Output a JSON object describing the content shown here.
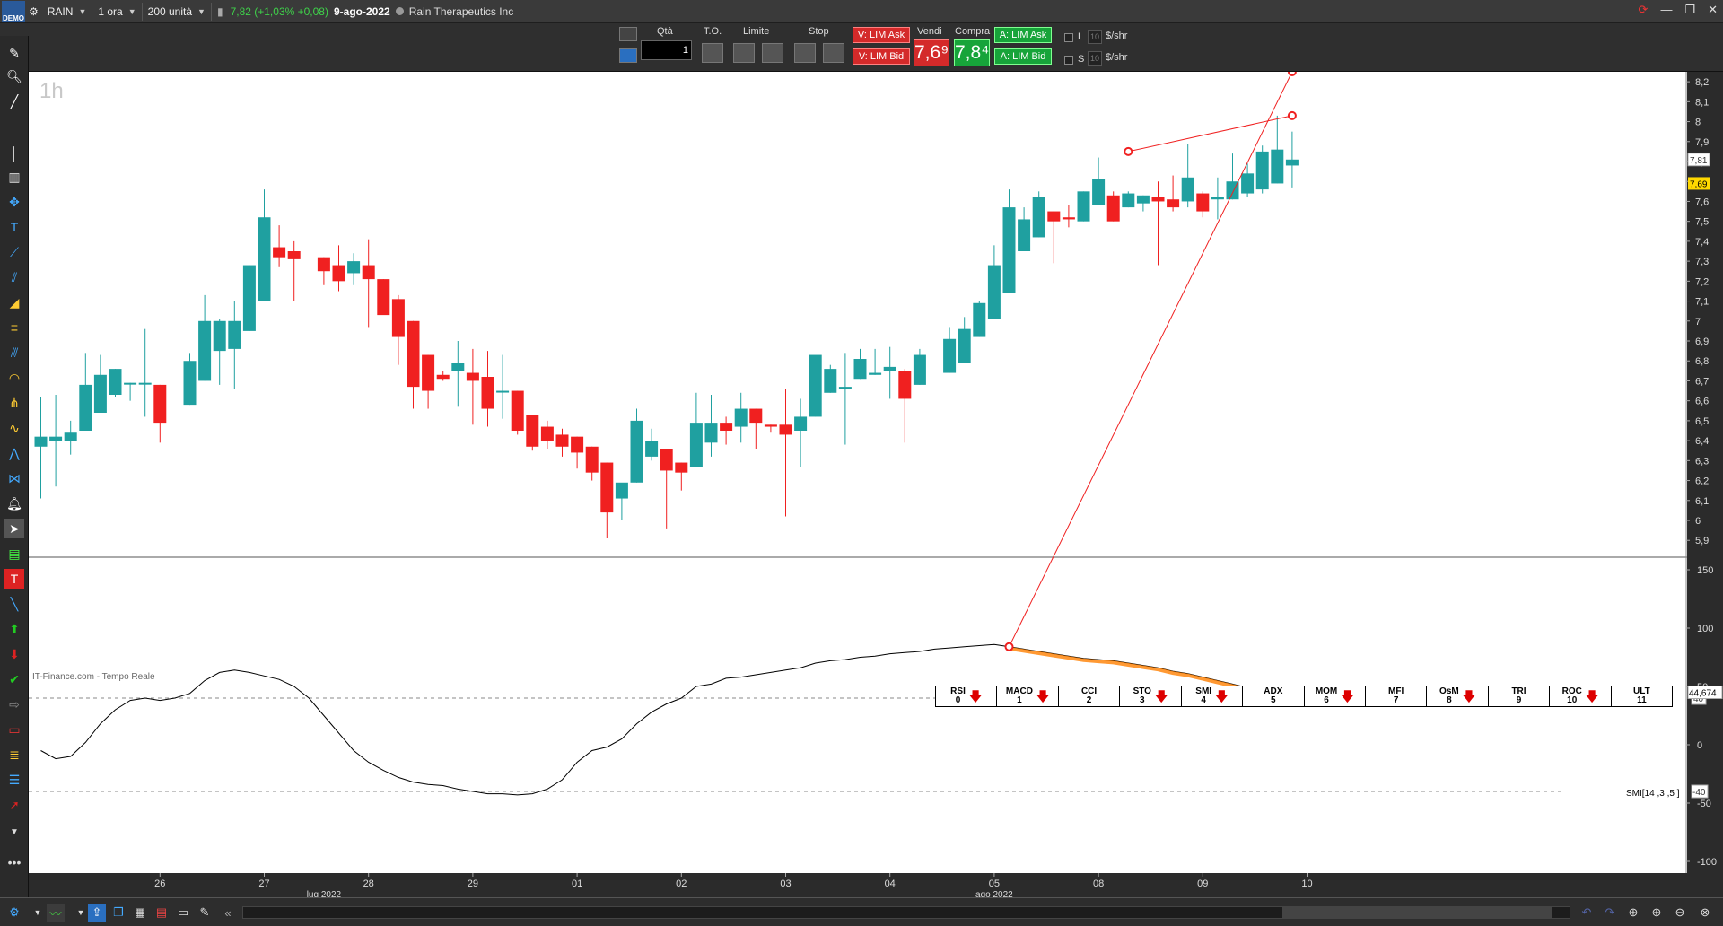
{
  "titlebar": {
    "logo": "DEMO",
    "symbol": "RAIN",
    "timeframe": "1 ora",
    "units": "200 unità",
    "price_change": "7,82 (+1,03% +0,08)",
    "date": "9-ago-2022",
    "company": "Rain Therapeutics Inc",
    "minimize": "—",
    "restore": "❐",
    "close": "✕"
  },
  "tradebar": {
    "qty_label": "Qtà",
    "qty_value": "1",
    "to_label": "T.O.",
    "limit_label": "Limite",
    "stop_label": "Stop",
    "sell_ask": "V: LIM Ask",
    "sell_bid": "V: LIM Bid",
    "vendi_label": "Vendi",
    "vendi_price": "7,6⁹",
    "compra_label": "Compra",
    "compra_price": "7,8⁴",
    "buy_ask": "A: LIM Ask",
    "buy_bid": "A: LIM Bid",
    "l_label": "L",
    "s_label": "S",
    "l_box": "10",
    "s_box": "10",
    "per_share1": "$/shr",
    "per_share2": "$/shr"
  },
  "chart": {
    "timeframe_watermark": "1h",
    "source_label": "IT-Finance.com - Tempo Reale",
    "indicator_label": "SMI[14 ,3 ,5 ]",
    "last_price_tag": "7,81",
    "bid_price_tag": "7,69",
    "smi_value_tag": "44,674",
    "smi_level_pos": "40",
    "smi_level_neg": "-40",
    "colors": {
      "up": "#1fa0a0",
      "down": "#f02020",
      "trend": "#f02020",
      "smi_line": "#000000",
      "smi_fill": "#ff8000"
    }
  },
  "indicator_tabs": [
    {
      "name": "RSI",
      "num": "0",
      "arrow": true
    },
    {
      "name": "MACD",
      "num": "1",
      "arrow": true
    },
    {
      "name": "CCI",
      "num": "2",
      "arrow": false
    },
    {
      "name": "STO",
      "num": "3",
      "arrow": true
    },
    {
      "name": "SMI",
      "num": "4",
      "arrow": true
    },
    {
      "name": "ADX",
      "num": "5",
      "arrow": false
    },
    {
      "name": "MOM",
      "num": "6",
      "arrow": true
    },
    {
      "name": "MFI",
      "num": "7",
      "arrow": false
    },
    {
      "name": "OsM",
      "num": "8",
      "arrow": true
    },
    {
      "name": "TRI",
      "num": "9",
      "arrow": false
    },
    {
      "name": "ROC",
      "num": "10",
      "arrow": true
    },
    {
      "name": "ULT",
      "num": "11",
      "arrow": false
    }
  ],
  "chart_data": {
    "type": "candlestick",
    "price_axis": {
      "ylim": [
        5.82,
        8.25
      ],
      "ticks": [
        "8,2",
        "8,1",
        "8",
        "7,9",
        "7,8",
        "7,7",
        "7,6",
        "7,5",
        "7,4",
        "7,3",
        "7,2",
        "7,1",
        "7",
        "6,9",
        "6,8",
        "6,7",
        "6,6",
        "6,5",
        "6,4",
        "6,3",
        "6,2",
        "6,1",
        "6",
        "5,9"
      ]
    },
    "x_axis": {
      "day_labels": [
        "26",
        "27",
        "28",
        "29",
        "01",
        "02",
        "03",
        "04",
        "05",
        "08",
        "09",
        "10"
      ],
      "month_labels": [
        "lug 2022",
        "ago 2022"
      ]
    },
    "candles": [
      {
        "o": 6.37,
        "h": 6.62,
        "l": 6.11,
        "c": 6.42
      },
      {
        "o": 6.4,
        "h": 6.63,
        "l": 6.17,
        "c": 6.42
      },
      {
        "o": 6.4,
        "h": 6.5,
        "l": 6.33,
        "c": 6.44
      },
      {
        "o": 6.45,
        "h": 6.84,
        "l": 6.45,
        "c": 6.68
      },
      {
        "o": 6.54,
        "h": 6.83,
        "l": 6.54,
        "c": 6.73
      },
      {
        "o": 6.63,
        "h": 6.76,
        "l": 6.62,
        "c": 6.76
      },
      {
        "o": 6.69,
        "h": 6.69,
        "l": 6.6,
        "c": 6.69
      },
      {
        "o": 6.69,
        "h": 6.96,
        "l": 6.52,
        "c": 6.69
      },
      {
        "o": 6.68,
        "h": 6.68,
        "l": 6.39,
        "c": 6.49
      },
      null,
      {
        "o": 6.58,
        "h": 6.84,
        "l": 6.58,
        "c": 6.8
      },
      {
        "o": 6.7,
        "h": 7.13,
        "l": 6.7,
        "c": 7.0
      },
      {
        "o": 6.85,
        "h": 7.01,
        "l": 6.68,
        "c": 7.0
      },
      {
        "o": 6.86,
        "h": 7.1,
        "l": 6.66,
        "c": 7.0
      },
      {
        "o": 6.95,
        "h": 7.28,
        "l": 6.95,
        "c": 7.28
      },
      {
        "o": 7.1,
        "h": 7.66,
        "l": 7.1,
        "c": 7.52
      },
      {
        "o": 7.37,
        "h": 7.48,
        "l": 7.27,
        "c": 7.32
      },
      {
        "o": 7.35,
        "h": 7.4,
        "l": 7.1,
        "c": 7.31
      },
      null,
      {
        "o": 7.32,
        "h": 7.32,
        "l": 7.18,
        "c": 7.25
      },
      {
        "o": 7.28,
        "h": 7.38,
        "l": 7.15,
        "c": 7.2
      },
      {
        "o": 7.24,
        "h": 7.34,
        "l": 7.18,
        "c": 7.3
      },
      {
        "o": 7.28,
        "h": 7.41,
        "l": 6.97,
        "c": 7.21
      },
      {
        "o": 7.21,
        "h": 7.21,
        "l": 7.05,
        "c": 7.03
      },
      {
        "o": 7.11,
        "h": 7.13,
        "l": 6.78,
        "c": 6.92
      },
      {
        "o": 7.0,
        "h": 7.0,
        "l": 6.56,
        "c": 6.67
      },
      {
        "o": 6.83,
        "h": 6.83,
        "l": 6.56,
        "c": 6.65
      },
      {
        "o": 6.73,
        "h": 6.75,
        "l": 6.7,
        "c": 6.71
      },
      {
        "o": 6.75,
        "h": 6.9,
        "l": 6.57,
        "c": 6.79
      },
      {
        "o": 6.74,
        "h": 6.86,
        "l": 6.48,
        "c": 6.7
      },
      {
        "o": 6.72,
        "h": 6.85,
        "l": 6.47,
        "c": 6.56
      },
      {
        "o": 6.65,
        "h": 6.83,
        "l": 6.51,
        "c": 6.65
      },
      {
        "o": 6.65,
        "h": 6.65,
        "l": 6.43,
        "c": 6.45
      },
      {
        "o": 6.53,
        "h": 6.53,
        "l": 6.35,
        "c": 6.37
      },
      {
        "o": 6.47,
        "h": 6.5,
        "l": 6.36,
        "c": 6.4
      },
      {
        "o": 6.43,
        "h": 6.46,
        "l": 6.32,
        "c": 6.37
      },
      {
        "o": 6.42,
        "h": 6.42,
        "l": 6.26,
        "c": 6.34
      },
      {
        "o": 6.37,
        "h": 6.37,
        "l": 6.2,
        "c": 6.24
      },
      {
        "o": 6.29,
        "h": 6.29,
        "l": 5.91,
        "c": 6.04
      },
      {
        "o": 6.11,
        "h": 6.16,
        "l": 6.0,
        "c": 6.19
      },
      {
        "o": 6.19,
        "h": 6.56,
        "l": 6.19,
        "c": 6.5
      },
      {
        "o": 6.32,
        "h": 6.46,
        "l": 6.3,
        "c": 6.4
      },
      {
        "o": 6.36,
        "h": 6.36,
        "l": 5.96,
        "c": 6.25
      },
      {
        "o": 6.29,
        "h": 6.29,
        "l": 6.15,
        "c": 6.24
      },
      {
        "o": 6.27,
        "h": 6.64,
        "l": 6.27,
        "c": 6.49
      },
      {
        "o": 6.39,
        "h": 6.63,
        "l": 6.32,
        "c": 6.49
      },
      {
        "o": 6.49,
        "h": 6.52,
        "l": 6.38,
        "c": 6.45
      },
      {
        "o": 6.47,
        "h": 6.64,
        "l": 6.39,
        "c": 6.56
      },
      {
        "o": 6.56,
        "h": 6.56,
        "l": 6.36,
        "c": 6.49
      },
      {
        "o": 6.48,
        "h": 6.48,
        "l": 6.44,
        "c": 6.47
      },
      {
        "o": 6.48,
        "h": 6.66,
        "l": 6.02,
        "c": 6.43
      },
      {
        "o": 6.45,
        "h": 6.61,
        "l": 6.27,
        "c": 6.52
      },
      {
        "o": 6.52,
        "h": 6.82,
        "l": 6.52,
        "c": 6.83
      },
      {
        "o": 6.64,
        "h": 6.78,
        "l": 6.64,
        "c": 6.76
      },
      {
        "o": 6.66,
        "h": 6.84,
        "l": 6.38,
        "c": 6.67
      },
      {
        "o": 6.71,
        "h": 6.86,
        "l": 6.71,
        "c": 6.81
      },
      {
        "o": 6.73,
        "h": 6.86,
        "l": 6.73,
        "c": 6.74
      },
      {
        "o": 6.75,
        "h": 6.87,
        "l": 6.61,
        "c": 6.77
      },
      {
        "o": 6.75,
        "h": 6.76,
        "l": 6.39,
        "c": 6.61
      },
      {
        "o": 6.68,
        "h": 6.86,
        "l": 6.68,
        "c": 6.83
      },
      null,
      {
        "o": 6.74,
        "h": 6.97,
        "l": 6.74,
        "c": 6.91
      },
      {
        "o": 6.79,
        "h": 7.02,
        "l": 6.79,
        "c": 6.96
      },
      {
        "o": 6.92,
        "h": 7.1,
        "l": 6.92,
        "c": 7.09
      },
      {
        "o": 7.01,
        "h": 7.38,
        "l": 7.01,
        "c": 7.28
      },
      {
        "o": 7.14,
        "h": 7.66,
        "l": 7.14,
        "c": 7.57
      },
      {
        "o": 7.35,
        "h": 7.57,
        "l": 7.35,
        "c": 7.51
      },
      {
        "o": 7.42,
        "h": 7.65,
        "l": 7.42,
        "c": 7.62
      },
      {
        "o": 7.55,
        "h": 7.55,
        "l": 7.29,
        "c": 7.5
      },
      {
        "o": 7.52,
        "h": 7.58,
        "l": 7.47,
        "c": 7.51
      },
      {
        "o": 7.5,
        "h": 7.65,
        "l": 7.5,
        "c": 7.65
      },
      {
        "o": 7.58,
        "h": 7.82,
        "l": 7.58,
        "c": 7.71
      },
      {
        "o": 7.63,
        "h": 7.65,
        "l": 7.5,
        "c": 7.5
      },
      {
        "o": 7.57,
        "h": 7.65,
        "l": 7.57,
        "c": 7.64
      },
      {
        "o": 7.59,
        "h": 7.63,
        "l": 7.55,
        "c": 7.63
      },
      {
        "o": 7.62,
        "h": 7.7,
        "l": 7.28,
        "c": 7.6
      },
      {
        "o": 7.61,
        "h": 7.73,
        "l": 7.55,
        "c": 7.57
      },
      {
        "o": 7.6,
        "h": 7.89,
        "l": 7.57,
        "c": 7.72
      },
      {
        "o": 7.64,
        "h": 7.65,
        "l": 7.52,
        "c": 7.55
      },
      {
        "o": 7.61,
        "h": 7.72,
        "l": 7.51,
        "c": 7.62
      },
      {
        "o": 7.61,
        "h": 7.84,
        "l": 7.61,
        "c": 7.7
      },
      {
        "o": 7.64,
        "h": 7.79,
        "l": 7.62,
        "c": 7.74
      },
      {
        "o": 7.66,
        "h": 7.88,
        "l": 7.64,
        "c": 7.85
      },
      {
        "o": 7.69,
        "h": 8.03,
        "l": 7.69,
        "c": 7.86
      },
      {
        "o": 7.78,
        "h": 7.95,
        "l": 7.67,
        "c": 7.81
      }
    ],
    "trendline": [
      [
        73,
        7.85
      ],
      [
        84,
        8.03
      ]
    ],
    "smi": {
      "ylim": [
        -110,
        160
      ],
      "ticks": [
        "150",
        "100",
        "50",
        "0",
        "-50",
        "-100"
      ],
      "levels": [
        40,
        -40
      ],
      "values": [
        -5,
        -12,
        -10,
        2,
        18,
        30,
        38,
        40,
        38,
        40,
        44,
        55,
        62,
        64,
        62,
        59,
        56,
        50,
        40,
        25,
        10,
        -5,
        -15,
        -22,
        -28,
        -32,
        -34,
        -35,
        -38,
        -40,
        -42,
        -42,
        -43,
        -42,
        -38,
        -30,
        -15,
        -5,
        -2,
        5,
        18,
        28,
        35,
        40,
        50,
        52,
        57,
        58,
        60,
        62,
        64,
        66,
        70,
        72,
        73,
        75,
        76,
        78,
        79,
        80,
        82,
        83,
        84,
        85,
        86,
        84,
        82,
        80,
        78,
        76,
        74,
        73,
        72,
        70,
        68,
        66,
        63,
        61,
        58,
        55,
        52,
        49,
        47,
        45
      ]
    }
  }
}
